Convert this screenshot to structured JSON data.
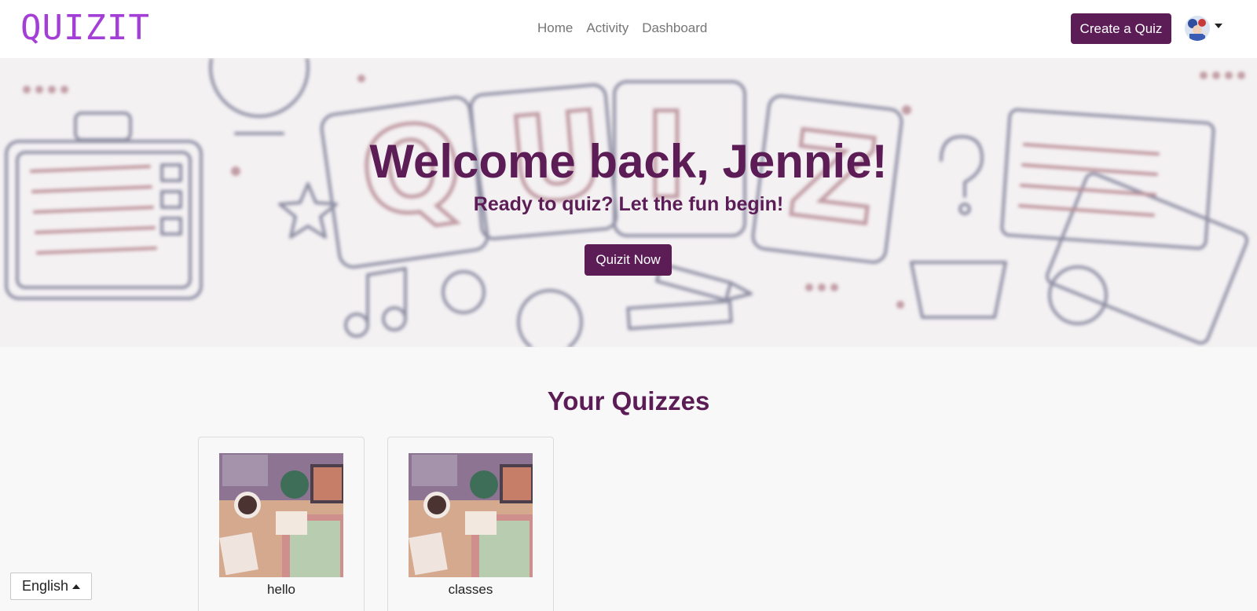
{
  "navbar": {
    "logo": "QUIZIT",
    "links": [
      "Home",
      "Activity",
      "Dashboard"
    ],
    "create_button": "Create a Quiz",
    "avatar_icon": "user-avatar-icon",
    "menu_icon": "caret-down-icon"
  },
  "hero": {
    "title": "Welcome back, Jennie!",
    "subtitle": "Ready to quiz? Let the fun begin!",
    "button": "Quizit Now",
    "background_letters": [
      "Q",
      "U",
      "I",
      "Z"
    ]
  },
  "quizzes": {
    "heading": "Your Quizzes",
    "items": [
      {
        "name": "hello"
      },
      {
        "name": "classes"
      }
    ]
  },
  "language": {
    "current": "English",
    "icon": "caret-up-icon"
  },
  "colors": {
    "brand": "#5c1d57",
    "logo": "#a33fd6",
    "background": "#f8f8f8"
  }
}
